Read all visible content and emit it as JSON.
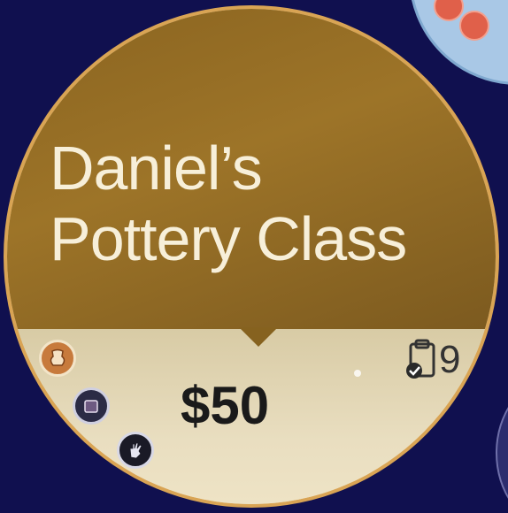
{
  "card": {
    "title_line1": "Daniel’s",
    "title_line2": "Pottery Class",
    "price": "$50",
    "stat_value": "9"
  },
  "icons": {
    "stat": "clipboard-check-icon",
    "token1": "pottery-token-icon",
    "token2": "square-token-icon",
    "token3": "hand-token-icon"
  },
  "colors": {
    "background": "#10104f",
    "header": "#9d7428",
    "body": "#ebe1c4",
    "rim": "#d9a454",
    "title_text": "#f7efd9",
    "price_text": "#1a1a1a"
  }
}
